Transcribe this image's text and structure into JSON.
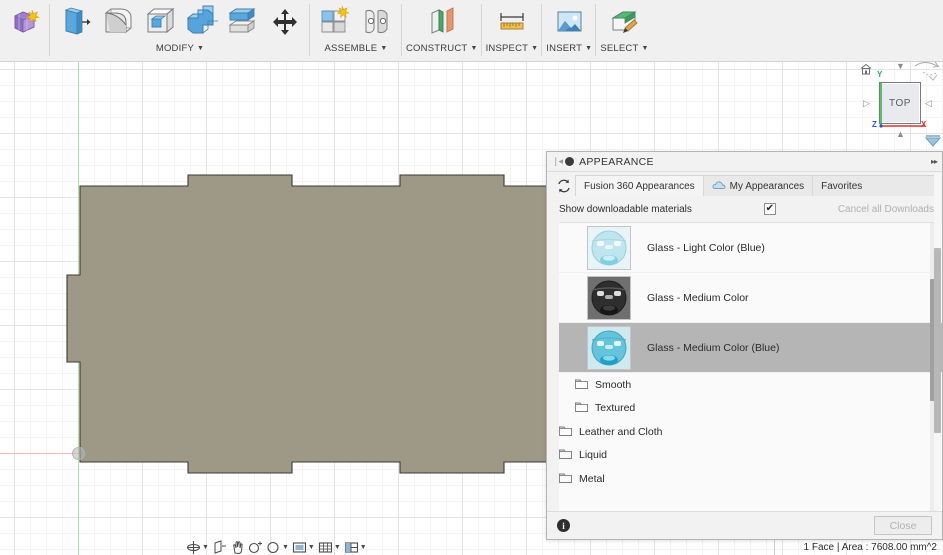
{
  "toolbar": {
    "groups": [
      {
        "label": "",
        "icons": [
          "form-create-icon"
        ]
      },
      {
        "label": "MODIFY",
        "has_caret": true,
        "icons": [
          "press-pull-icon",
          "fillet-icon",
          "shell-icon",
          "combine-icon",
          "split-face-icon",
          "move-copy-icon"
        ]
      },
      {
        "label": "ASSEMBLE",
        "has_caret": true,
        "icons": [
          "new-component-icon",
          "joint-icon"
        ]
      },
      {
        "label": "CONSTRUCT",
        "has_caret": true,
        "icons": [
          "offset-plane-icon"
        ]
      },
      {
        "label": "INSPECT",
        "has_caret": true,
        "icons": [
          "measure-icon"
        ]
      },
      {
        "label": "INSERT",
        "has_caret": true,
        "icons": [
          "insert-image-icon"
        ]
      },
      {
        "label": "SELECT",
        "has_caret": true,
        "icons": [
          "select-paint-icon"
        ]
      }
    ]
  },
  "viewcube": {
    "face_label": "TOP",
    "home_icon": "home-icon",
    "orbit_icon": "orbit-arc-icon",
    "compass_icon": "compass-icon",
    "axes": {
      "y": "Y",
      "z": "Z",
      "x": "X"
    },
    "axis_colors": {
      "y": "#2bb24a",
      "z": "#2d4ed8",
      "x": "#d8342d"
    }
  },
  "canvas": {
    "body_fill": "#9e9887",
    "body_stroke": "#3c3a35",
    "axis_x_color": "#f0b8b8",
    "axis_y_color": "#a9e3ab",
    "origin_name": "origin-point",
    "grid": true
  },
  "navbar": {
    "items": [
      {
        "icon": "orbit-icon",
        "caret": true
      },
      {
        "icon": "look-at-icon",
        "caret": false
      },
      {
        "icon": "pan-icon",
        "caret": false
      },
      {
        "icon": "zoom-icon",
        "caret": false
      },
      {
        "icon": "fit-icon",
        "caret": true
      },
      {
        "icon": "display-settings-icon",
        "caret": true
      },
      {
        "icon": "grid-snap-icon",
        "caret": true
      },
      {
        "icon": "viewports-icon",
        "caret": true
      }
    ]
  },
  "statusbar": {
    "text": "1 Face | Area : 7608.00 mm^2"
  },
  "appearance_panel": {
    "title": "APPEARANCE",
    "grip_icon": "grip-handle-icon",
    "collapse_icon": "collapse-dot-icon",
    "expand_icon": "expand-right-icon",
    "refresh_icon": "refresh-icon",
    "tabs": [
      {
        "label": "Fusion 360 Appearances",
        "active": true,
        "icon": null
      },
      {
        "label": "My Appearances",
        "active": false,
        "icon": "cloud-icon"
      },
      {
        "label": "Favorites",
        "active": false,
        "icon": null
      }
    ],
    "downloadable": {
      "label": "Show downloadable materials",
      "checked": true,
      "check_glyph": "✔",
      "cancel_label": "Cancel all Downloads"
    },
    "materials": [
      {
        "name": "Glass - Light Color (Blue)",
        "selected": false,
        "swatch": "glass-light-blue-swatch",
        "tint": "#bfe6ee"
      },
      {
        "name": "Glass - Medium Color",
        "selected": false,
        "swatch": "glass-medium-gray-swatch",
        "tint": "#6d6d6d"
      },
      {
        "name": "Glass - Medium Color (Blue)",
        "selected": true,
        "swatch": "glass-medium-blue-swatch",
        "tint": "#63c4dc"
      }
    ],
    "folders": [
      {
        "label": "Smooth",
        "indent": true,
        "icon": "folder-icon"
      },
      {
        "label": "Textured",
        "indent": true,
        "icon": "folder-icon"
      },
      {
        "label": "Leather and Cloth",
        "indent": false,
        "icon": "folder-icon"
      },
      {
        "label": "Liquid",
        "indent": false,
        "icon": "folder-icon"
      },
      {
        "label": "Metal",
        "indent": false,
        "icon": "folder-icon"
      }
    ],
    "footer": {
      "info_icon": "info-icon",
      "info_glyph": "i",
      "close_label": "Close"
    },
    "scrollbars": {
      "list": {
        "name": "material-list-scrollbar"
      },
      "panel": {
        "name": "panel-scrollbar"
      }
    }
  }
}
